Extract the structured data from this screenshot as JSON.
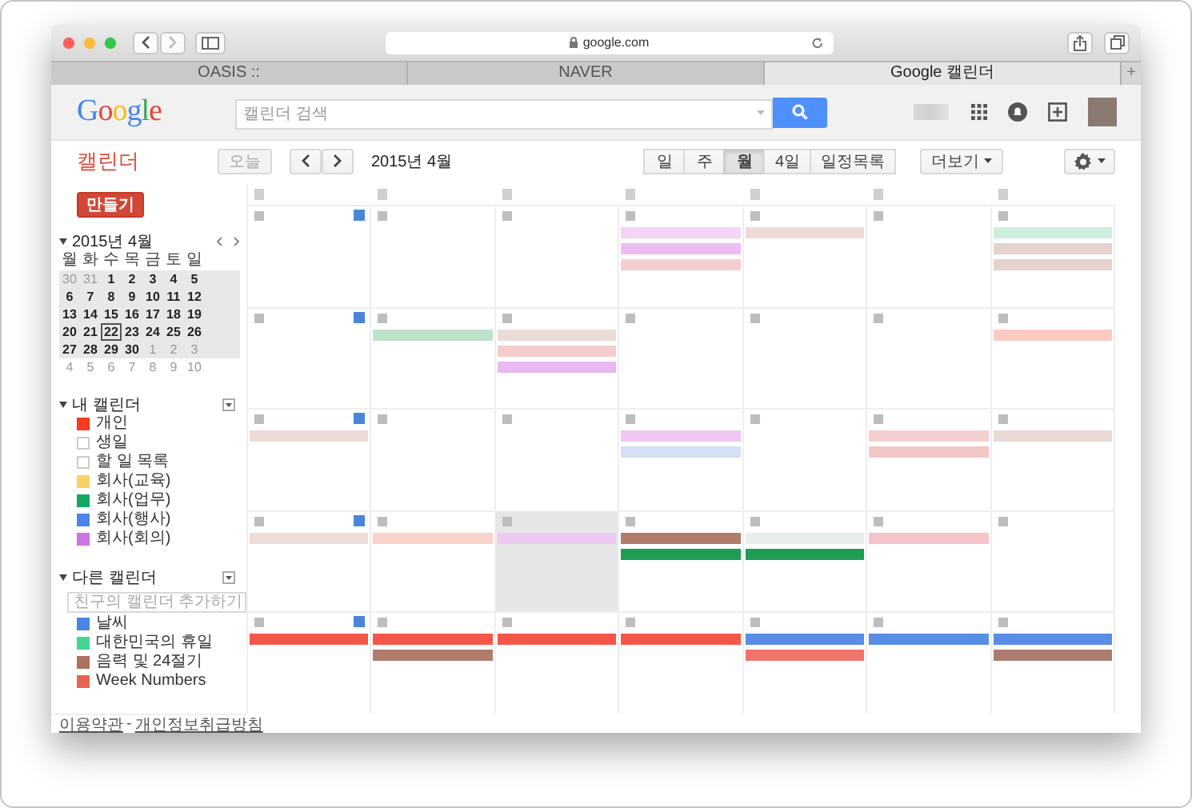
{
  "browser": {
    "url": "google.com",
    "tabs": [
      {
        "label": "OASIS ::",
        "selected": false
      },
      {
        "label": "NAVER",
        "selected": false
      },
      {
        "label": "Google 캘린더",
        "selected": true
      }
    ],
    "new_tab": "+"
  },
  "header": {
    "logo": "Google",
    "search": {
      "placeholder": "캘린더 검색"
    }
  },
  "toolbar": {
    "app_title": "캘린더",
    "today_button": {
      "label": "오늘",
      "disabled": true
    },
    "period": "2015년 4월",
    "views": [
      {
        "label": "일",
        "selected": false
      },
      {
        "label": "주",
        "selected": false
      },
      {
        "label": "월",
        "selected": true
      },
      {
        "label": "4일",
        "selected": false
      },
      {
        "label": "일정목록",
        "selected": false
      }
    ],
    "more": "더보기"
  },
  "sidebar": {
    "create": "만들기",
    "mini_calendar": {
      "title": "2015년 4월",
      "weekdays": [
        "월",
        "화",
        "수",
        "목",
        "금",
        "토",
        "일"
      ],
      "weeks": [
        {
          "in_view": true,
          "days": [
            {
              "d": "30",
              "muted": true,
              "today": false
            },
            {
              "d": "31",
              "muted": true,
              "today": false
            },
            {
              "d": "1",
              "muted": false,
              "today": false
            },
            {
              "d": "2",
              "muted": false,
              "today": false
            },
            {
              "d": "3",
              "muted": false,
              "today": false
            },
            {
              "d": "4",
              "muted": false,
              "today": false
            },
            {
              "d": "5",
              "muted": false,
              "today": false
            }
          ]
        },
        {
          "in_view": true,
          "days": [
            {
              "d": "6",
              "muted": false,
              "today": false
            },
            {
              "d": "7",
              "muted": false,
              "today": false
            },
            {
              "d": "8",
              "muted": false,
              "today": false
            },
            {
              "d": "9",
              "muted": false,
              "today": false
            },
            {
              "d": "10",
              "muted": false,
              "today": false
            },
            {
              "d": "11",
              "muted": false,
              "today": false
            },
            {
              "d": "12",
              "muted": false,
              "today": false
            }
          ]
        },
        {
          "in_view": true,
          "days": [
            {
              "d": "13",
              "muted": false,
              "today": false
            },
            {
              "d": "14",
              "muted": false,
              "today": false
            },
            {
              "d": "15",
              "muted": false,
              "today": false
            },
            {
              "d": "16",
              "muted": false,
              "today": false
            },
            {
              "d": "17",
              "muted": false,
              "today": false
            },
            {
              "d": "18",
              "muted": false,
              "today": false
            },
            {
              "d": "19",
              "muted": false,
              "today": false
            }
          ]
        },
        {
          "in_view": true,
          "days": [
            {
              "d": "20",
              "muted": false,
              "today": false
            },
            {
              "d": "21",
              "muted": false,
              "today": false
            },
            {
              "d": "22",
              "muted": false,
              "today": true
            },
            {
              "d": "23",
              "muted": false,
              "today": false
            },
            {
              "d": "24",
              "muted": false,
              "today": false
            },
            {
              "d": "25",
              "muted": false,
              "today": false
            },
            {
              "d": "26",
              "muted": false,
              "today": false
            }
          ]
        },
        {
          "in_view": true,
          "days": [
            {
              "d": "27",
              "muted": false,
              "today": false
            },
            {
              "d": "28",
              "muted": false,
              "today": false
            },
            {
              "d": "29",
              "muted": false,
              "today": false
            },
            {
              "d": "30",
              "muted": false,
              "today": false
            },
            {
              "d": "1",
              "muted": true,
              "today": false
            },
            {
              "d": "2",
              "muted": true,
              "today": false
            },
            {
              "d": "3",
              "muted": true,
              "today": false
            }
          ]
        },
        {
          "in_view": false,
          "days": [
            {
              "d": "4",
              "muted": true,
              "today": false
            },
            {
              "d": "5",
              "muted": true,
              "today": false
            },
            {
              "d": "6",
              "muted": true,
              "today": false
            },
            {
              "d": "7",
              "muted": true,
              "today": false
            },
            {
              "d": "8",
              "muted": true,
              "today": false
            },
            {
              "d": "9",
              "muted": true,
              "today": false
            },
            {
              "d": "10",
              "muted": true,
              "today": false
            }
          ]
        }
      ]
    },
    "my_calendars": {
      "title": "내 캘린더",
      "items": [
        {
          "name": "개인",
          "checked": true,
          "color": "#f83a22"
        },
        {
          "name": "생일",
          "checked": false
        },
        {
          "name": "할 일 목록",
          "checked": false
        },
        {
          "name": "회사(교육)",
          "checked": true,
          "color": "#fad165"
        },
        {
          "name": "회사(업무)",
          "checked": true,
          "color": "#16a765"
        },
        {
          "name": "회사(행사)",
          "checked": true,
          "color": "#4986e7"
        },
        {
          "name": "회사(회의)",
          "checked": true,
          "color": "#cd74e6"
        }
      ]
    },
    "other_calendars": {
      "title": "다른 캘린더",
      "add_placeholder": "친구의 캘린더 추가하기",
      "items": [
        {
          "name": "날씨",
          "checked": true,
          "color": "#4986e7"
        },
        {
          "name": "대한민국의 휴일",
          "checked": true,
          "color": "#42d692"
        },
        {
          "name": "음력 및 24절기",
          "checked": true,
          "color": "#ac725e"
        },
        {
          "name": "Week Numbers",
          "checked": true,
          "color": "#e66550"
        }
      ]
    },
    "footer": {
      "terms": "이용약관",
      "separator": "-",
      "privacy": "개인정보취급방침"
    }
  },
  "month_grid": {
    "weeks": [
      {
        "days": [
          {
            "today": false
          },
          {
            "today": false
          },
          {
            "today": false
          },
          {
            "today": false,
            "events": [
              {
                "color": "#f3d4f6"
              },
              {
                "color": "#ecbdf3"
              },
              {
                "color": "#f5cfcf"
              }
            ]
          },
          {
            "today": false,
            "events": [
              {
                "color": "#ecdcd8"
              }
            ]
          },
          {
            "today": false
          },
          {
            "today": false,
            "events": [
              {
                "color": "#cdeedd"
              },
              {
                "color": "#e6d3cf"
              },
              {
                "color": "#e6d3cf"
              }
            ]
          }
        ]
      },
      {
        "days": [
          {
            "today": false
          },
          {
            "today": false,
            "events": [
              {
                "color": "#bfe2cc"
              }
            ]
          },
          {
            "today": false,
            "events": [
              {
                "color": "#ecdcd8"
              },
              {
                "color": "#f5cccc"
              },
              {
                "color": "#eab8f2"
              }
            ]
          },
          {
            "today": false
          },
          {
            "today": false
          },
          {
            "today": false
          },
          {
            "today": false,
            "events": [
              {
                "color": "#fccac1"
              }
            ]
          }
        ]
      },
      {
        "days": [
          {
            "today": false,
            "events": [
              {
                "color": "#ecdcd8"
              }
            ]
          },
          {
            "today": false
          },
          {
            "today": false
          },
          {
            "today": false,
            "events": [
              {
                "color": "#f0c6f3"
              },
              {
                "color": "#d3e0f5"
              }
            ]
          },
          {
            "today": false
          },
          {
            "today": false,
            "events": [
              {
                "color": "#f5cfcf"
              },
              {
                "color": "#f3c6c6"
              }
            ]
          },
          {
            "today": false,
            "events": [
              {
                "color": "#e9d9d5"
              }
            ]
          }
        ]
      },
      {
        "days": [
          {
            "today": false,
            "events": [
              {
                "color": "#eedcd8"
              }
            ]
          },
          {
            "today": false,
            "events": [
              {
                "color": "#fbd2cb"
              }
            ]
          },
          {
            "today": true,
            "events": [
              {
                "color": "#ecc9f0"
              }
            ]
          },
          {
            "today": false,
            "events": [
              {
                "color": "#b07c6c"
              },
              {
                "color": "#1f9d55"
              }
            ]
          },
          {
            "today": false,
            "events": [
              {
                "color": "#e6efe9"
              },
              {
                "color": "#1f9d55"
              }
            ]
          },
          {
            "today": false,
            "events": [
              {
                "color": "#f4c4c8"
              }
            ]
          },
          {
            "today": false
          }
        ]
      },
      {
        "days": [
          {
            "today": false,
            "events": [
              {
                "color": "#f4574a"
              }
            ]
          },
          {
            "today": false,
            "events": [
              {
                "color": "#f4574a"
              },
              {
                "color": "#b07c6c"
              }
            ]
          },
          {
            "today": false,
            "events": [
              {
                "color": "#f4574a"
              }
            ]
          },
          {
            "today": false,
            "events": [
              {
                "color": "#f4574a"
              }
            ]
          },
          {
            "today": false,
            "events": [
              {
                "color": "#5a8de6"
              },
              {
                "color": "#f0746a"
              }
            ]
          },
          {
            "today": false,
            "events": [
              {
                "color": "#5a8de6"
              }
            ]
          },
          {
            "today": false,
            "events": [
              {
                "color": "#5a8de6"
              },
              {
                "color": "#ab7d70"
              }
            ]
          }
        ]
      }
    ]
  }
}
